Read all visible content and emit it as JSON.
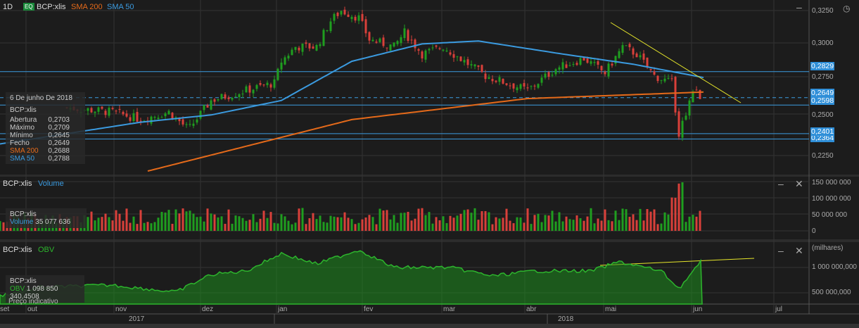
{
  "header": {
    "interval": "1D",
    "eq_badge": "EQ",
    "symbol": "BCP:xlis",
    "sma200": "SMA 200",
    "sma50": "SMA 50"
  },
  "tooltip": {
    "date": "6 De junho De 2018",
    "symbol": "BCP:xlis",
    "rows": [
      {
        "label": "Abertura",
        "value": "0,2703"
      },
      {
        "label": "Máximo",
        "value": "0,2709"
      },
      {
        "label": "Mínimo",
        "value": "0,2645"
      },
      {
        "label": "Fecho",
        "value": "0,2649"
      },
      {
        "label": "SMA 200",
        "value": "0,2688"
      },
      {
        "label": "SMA 50",
        "value": "0,2788"
      }
    ]
  },
  "price_axis": [
    "0,3250",
    "0,3000",
    "0,2750",
    "0,2500",
    "0,2250"
  ],
  "price_tags": [
    "0,2829",
    "0,2649",
    "0,2598",
    "0,2401",
    "0,2364"
  ],
  "volume_panel": {
    "symbol": "BCP:xlis",
    "title": "Volume",
    "tip_symbol": "BCP:xlis",
    "tip_label": "Volume",
    "tip_value": "35 077 636",
    "axis": [
      "150 000 000",
      "100 000 000",
      "50 000 000",
      "0"
    ]
  },
  "obv_panel": {
    "symbol": "BCP:xlis",
    "title": "OBV",
    "unit": "(milhares)",
    "tip_symbol": "BCP:xlis",
    "tip_label": "OBV",
    "tip_value": "1 098 850 340,4508",
    "tip_note": "Preço indicativo",
    "axis": [
      "1 000 000,000",
      "500 000,000"
    ]
  },
  "months": [
    "set",
    "out",
    "nov",
    "dez",
    "jan",
    "fev",
    "mar",
    "abr",
    "mai",
    "jun",
    "jul"
  ],
  "years": [
    "2017",
    "2018"
  ],
  "colors": {
    "up": "#1f9e1f",
    "down": "#d9403a",
    "sma50": "#3b9be0",
    "sma200": "#e56a1a",
    "trend": "#e6e62a"
  },
  "chart_data": {
    "type": "candlestick",
    "ylim": [
      0.22,
      0.335
    ],
    "close_path": [
      [
        95,
        0.258
      ],
      [
        160,
        0.255
      ],
      [
        200,
        0.25
      ],
      [
        240,
        0.255
      ],
      [
        268,
        0.243
      ],
      [
        300,
        0.263
      ],
      [
        350,
        0.27
      ],
      [
        390,
        0.275
      ],
      [
        400,
        0.29
      ],
      [
        420,
        0.3
      ],
      [
        450,
        0.3
      ],
      [
        470,
        0.318
      ],
      [
        485,
        0.325
      ],
      [
        510,
        0.32
      ],
      [
        525,
        0.305
      ],
      [
        560,
        0.3
      ],
      [
        575,
        0.31
      ],
      [
        600,
        0.295
      ],
      [
        630,
        0.3
      ],
      [
        660,
        0.29
      ],
      [
        690,
        0.28
      ],
      [
        720,
        0.275
      ],
      [
        750,
        0.27
      ],
      [
        790,
        0.285
      ],
      [
        830,
        0.292
      ],
      [
        860,
        0.282
      ],
      [
        885,
        0.3
      ],
      [
        905,
        0.295
      ],
      [
        930,
        0.28
      ],
      [
        955,
        0.275
      ],
      [
        965,
        0.24
      ],
      [
        975,
        0.255
      ],
      [
        985,
        0.27
      ],
      [
        998,
        0.2649
      ]
    ],
    "sma50": [
      [
        0,
        0.233
      ],
      [
        200,
        0.248
      ],
      [
        300,
        0.253
      ],
      [
        400,
        0.263
      ],
      [
        500,
        0.29
      ],
      [
        600,
        0.302
      ],
      [
        680,
        0.304
      ],
      [
        800,
        0.295
      ],
      [
        900,
        0.288
      ],
      [
        1000,
        0.2788
      ]
    ],
    "sma200": [
      [
        210,
        0.2143
      ],
      [
        500,
        0.2498
      ],
      [
        750,
        0.2643
      ],
      [
        1000,
        0.2688
      ]
    ],
    "levels": [
      0.2829,
      0.2649,
      0.2598,
      0.2401,
      0.2364
    ],
    "obv_path": [
      [
        0,
        420
      ],
      [
        60,
        408
      ],
      [
        160,
        405
      ],
      [
        250,
        415
      ],
      [
        300,
        390
      ],
      [
        350,
        385
      ],
      [
        400,
        360
      ],
      [
        450,
        375
      ],
      [
        510,
        355
      ],
      [
        560,
        380
      ],
      [
        640,
        380
      ],
      [
        700,
        392
      ],
      [
        760,
        385
      ],
      [
        840,
        385
      ],
      [
        880,
        372
      ],
      [
        940,
        385
      ],
      [
        965,
        410
      ],
      [
        998,
        370
      ]
    ]
  }
}
